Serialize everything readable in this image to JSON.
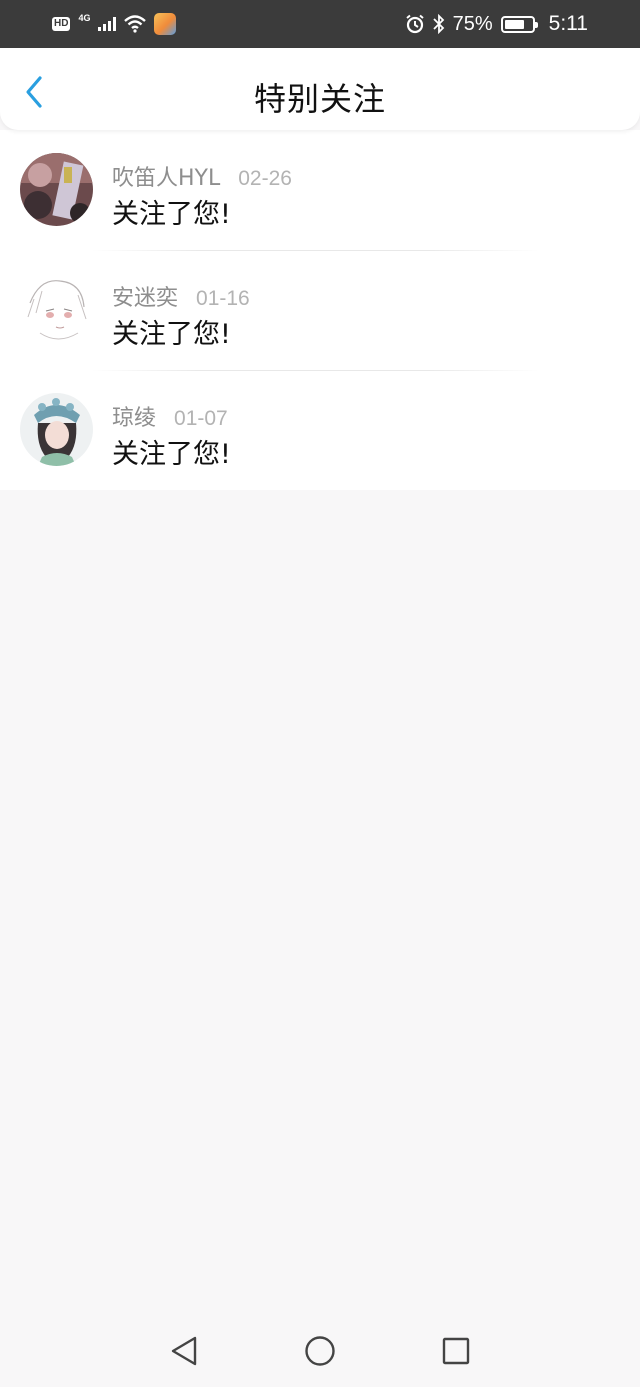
{
  "status_bar": {
    "hd": "HD",
    "network": "4G",
    "battery_percent_text": "75%",
    "battery_level": 0.75,
    "time": "5:11"
  },
  "header": {
    "title": "特别关注",
    "back_icon": "chevron-left-icon",
    "accent_color": "#2a9fe0"
  },
  "notifications": [
    {
      "name": "吹笛人HYL",
      "date": "02-26",
      "message": "关注了您!"
    },
    {
      "name": "安迷奕",
      "date": "01-16",
      "message": "关注了您!"
    },
    {
      "name": "琼绫",
      "date": "01-07",
      "message": "关注了您!"
    }
  ],
  "nav_bar": {
    "back_icon": "triangle-back-icon",
    "home_icon": "circle-home-icon",
    "recents_icon": "square-recents-icon"
  }
}
